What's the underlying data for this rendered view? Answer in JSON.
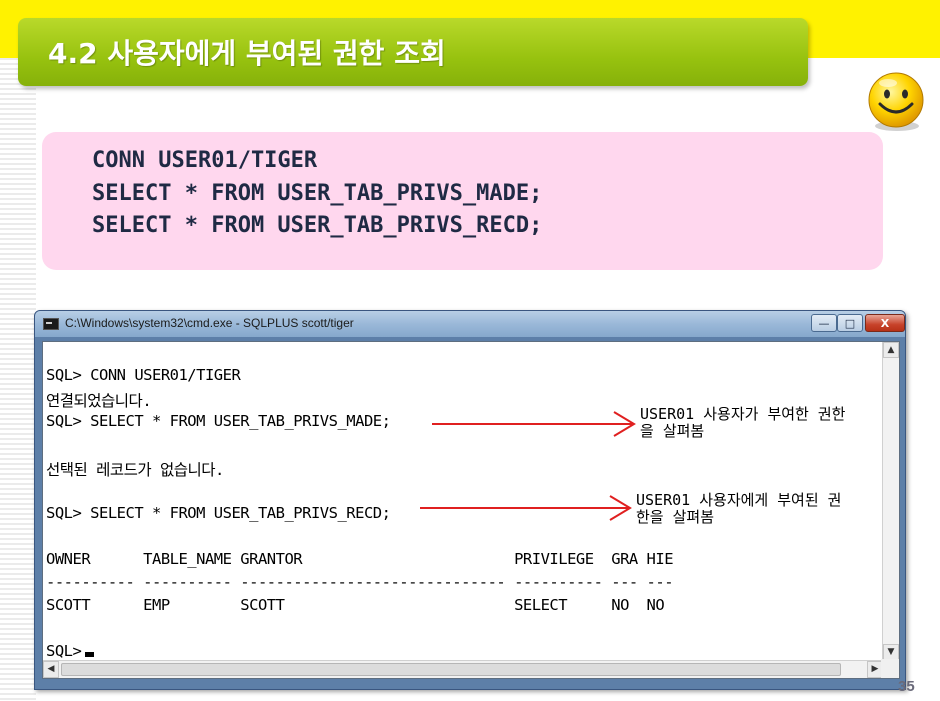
{
  "slide": {
    "title": "4.2 사용자에게 부여된 권한 조회",
    "page_number": "35",
    "colors": {
      "top_band": "#fff200",
      "title_bar": "#97c20f",
      "code_box": "#ffd7ee",
      "code_text": "#1f2a44",
      "arrow": "#e02020"
    }
  },
  "code": {
    "lines": [
      "CONN USER01/TIGER",
      "SELECT * FROM USER_TAB_PRIVS_MADE;",
      "SELECT * FROM USER_TAB_PRIVS_RECD;"
    ]
  },
  "cmd": {
    "window_title": "C:\\Windows\\system32\\cmd.exe - SQLPLUS  scott/tiger",
    "buttons": {
      "minimize": "—",
      "maximize": "□",
      "close": "X"
    },
    "console": [
      "SQL> CONN USER01/TIGER",
      "연결되었습니다.",
      "SQL> SELECT * FROM USER_TAB_PRIVS_MADE;",
      "",
      "선택된 레코드가 없습니다.",
      "",
      "SQL> SELECT * FROM USER_TAB_PRIVS_RECD;",
      "",
      "OWNER      TABLE_NAME GRANTOR                        PRIVILEGE  GRA HIE",
      "---------- ---------- ------------------------------ ---------- --- ---",
      "SCOTT      EMP        SCOTT                          SELECT     NO  NO",
      "",
      "SQL>"
    ]
  },
  "annotations": {
    "made": "USER01 사용자가 부여한 권한\n을 살펴봄",
    "recd": "USER01 사용자에게 부여된 권\n한을 살펴봄"
  },
  "icons": {
    "smiley": "smiley-face-icon",
    "cmd": "cmd-window-icon",
    "cursor": "cursor-block"
  }
}
